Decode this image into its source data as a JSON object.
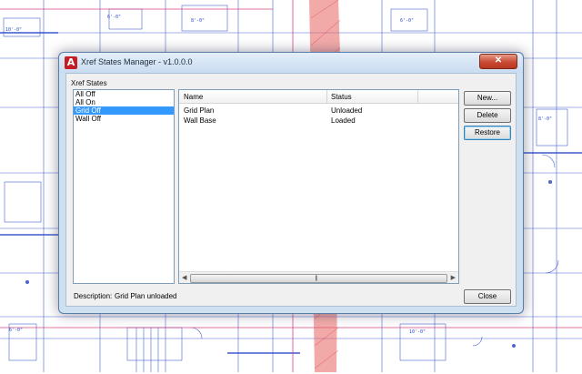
{
  "window": {
    "title": "Xref States Manager - v1.0.0.0",
    "app_icon": "autocad-icon",
    "close_glyph": "✕"
  },
  "states_group": {
    "label": "Xref States",
    "items": [
      {
        "label": "All Off",
        "selected": false
      },
      {
        "label": "All On",
        "selected": false
      },
      {
        "label": "Grid Off",
        "selected": true
      },
      {
        "label": "Wall Off",
        "selected": false
      }
    ]
  },
  "xref_table": {
    "columns": [
      "Name",
      "Status"
    ],
    "rows": [
      {
        "name": "Grid Plan",
        "status": "Unloaded"
      },
      {
        "name": "Wall Base",
        "status": "Loaded"
      }
    ]
  },
  "buttons": {
    "new": "New...",
    "delete": "Delete",
    "restore": "Restore",
    "close": "Close"
  },
  "description": {
    "label": "Description:",
    "value": "Grid Plan unloaded"
  },
  "colors": {
    "selection": "#3399ff",
    "cad_lines": "#2b49c9",
    "cad_accent": "#d1307a",
    "hatch": "#e0524e"
  }
}
